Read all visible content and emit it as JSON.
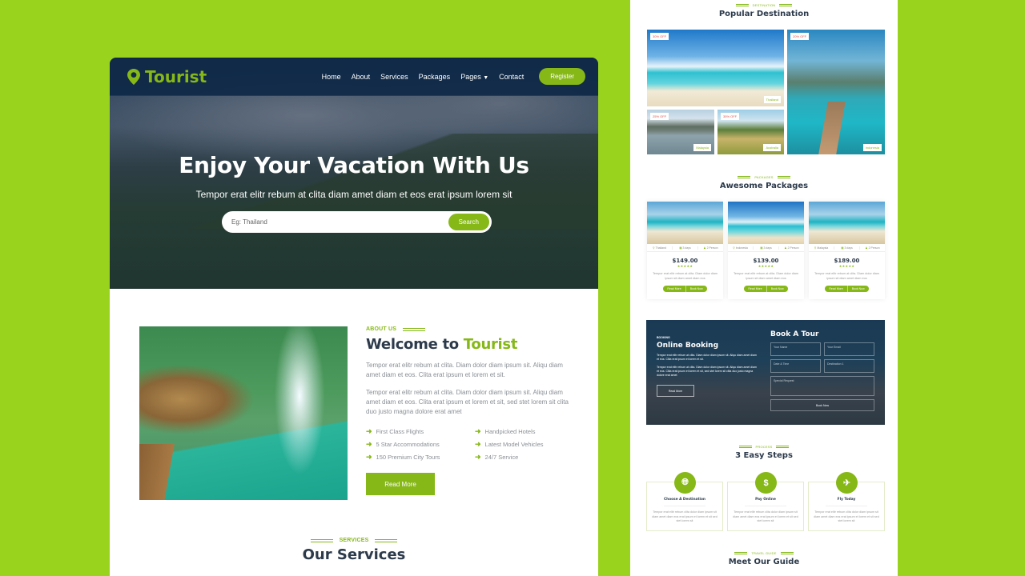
{
  "colors": {
    "accent": "#86b817",
    "background": "#9ad31e",
    "heading": "#2c3a4b",
    "nav_bg": "#0c2746"
  },
  "nav": {
    "logo": "Tourist",
    "logo_icon": "map-marker-icon",
    "links": [
      "Home",
      "About",
      "Services",
      "Packages",
      "Pages",
      "Contact"
    ],
    "register": "Register"
  },
  "hero": {
    "title": "Enjoy Your Vacation With Us",
    "subtitle": "Tempor erat elitr rebum at clita diam amet diam et eos erat ipsum lorem sit",
    "search_placeholder": "Eg: Thailand",
    "search_button": "Search"
  },
  "about": {
    "eyebrow": "ABOUT US",
    "title_prefix": "Welcome to ",
    "title_highlight": "Tourist",
    "p1": "Tempor erat elitr rebum at clita. Diam dolor diam ipsum sit. Aliqu diam amet diam et eos. Clita erat ipsum et lorem et sit.",
    "p2": "Tempor erat elitr rebum at clita. Diam dolor diam ipsum sit. Aliqu diam amet diam et eos. Clita erat ipsum et lorem et sit, sed stet lorem sit clita duo justo magna dolore erat amet",
    "features": [
      "First Class Flights",
      "Handpicked Hotels",
      "5 Star Accommodations",
      "Latest Model Vehicles",
      "150 Premium City Tours",
      "24/7 Service"
    ],
    "button": "Read More"
  },
  "services": {
    "eyebrow": "SERVICES",
    "title": "Our Services"
  },
  "destination": {
    "eyebrow": "DESTINATION",
    "title": "Popular Destination",
    "items": [
      {
        "discount": "30% OFF",
        "name": "Thailand"
      },
      {
        "discount": "20% OFF",
        "name": "Indonesia"
      },
      {
        "discount": "25% OFF",
        "name": "Malaysia"
      },
      {
        "discount": "35% OFF",
        "name": "Australia"
      }
    ]
  },
  "packages": {
    "eyebrow": "PACKAGES",
    "title": "Awesome Packages",
    "items": [
      {
        "location": "Thailand",
        "duration": "3 days",
        "persons": "2 Person",
        "price": "$149.00",
        "rating": "★★★★★",
        "desc": "Tempor erat elitr rebum at clita. Diam dolor diam ipsum sit diam amet diam eos",
        "read_more": "Read More",
        "book_now": "Book Now"
      },
      {
        "location": "Indonesia",
        "duration": "3 days",
        "persons": "2 Person",
        "price": "$139.00",
        "rating": "★★★★★",
        "desc": "Tempor erat elitr rebum at clita. Diam dolor diam ipsum sit diam amet diam eos",
        "read_more": "Read More",
        "book_now": "Book Now"
      },
      {
        "location": "Malaysia",
        "duration": "3 days",
        "persons": "2 Person",
        "price": "$189.00",
        "rating": "★★★★★",
        "desc": "Tempor erat elitr rebum at clita. Diam dolor diam ipsum sit diam amet diam eos",
        "read_more": "Read More",
        "book_now": "Book Now"
      }
    ]
  },
  "booking": {
    "eyebrow": "BOOKING",
    "title": "Online Booking",
    "p1": "Tempor erat elitr rebum at clita. Diam dolor diam ipsum sit. Aliqu diam amet diam et eos. Clita erat ipsum et lorem et sit.",
    "p2": "Tempor erat elitr rebum at clita. Diam dolor diam ipsum sit. Aliqu diam amet diam et eos. Clita erat ipsum et lorem et sit, sed stet lorem sit clita duo justo magna dolore erat amet",
    "button": "Read More",
    "form_title": "Book A Tour",
    "fields": {
      "name": "Your Name",
      "email": "Your Email",
      "datetime": "Date & Time",
      "destination": "Destination 1",
      "request": "Special Request"
    },
    "submit": "Book Now"
  },
  "process": {
    "eyebrow": "PROCESS",
    "title": "3 Easy Steps",
    "steps": [
      {
        "icon": "globe-icon",
        "title": "Choose A Destination",
        "desc": "Tempor erat elitr rebum clita dolor diam ipsum sit diam amet diam eos erat ipsum et lorem et sit sed stet lorem sit"
      },
      {
        "icon": "dollar-icon",
        "title": "Pay Online",
        "desc": "Tempor erat elitr rebum clita dolor diam ipsum sit diam amet diam eos erat ipsum et lorem et sit sed stet lorem sit"
      },
      {
        "icon": "plane-icon",
        "title": "Fly Today",
        "desc": "Tempor erat elitr rebum clita dolor diam ipsum sit diam amet diam eos erat ipsum et lorem et sit sed stet lorem sit"
      }
    ]
  },
  "guide": {
    "eyebrow": "TRAVEL GUIDE",
    "title": "Meet Our Guide"
  }
}
